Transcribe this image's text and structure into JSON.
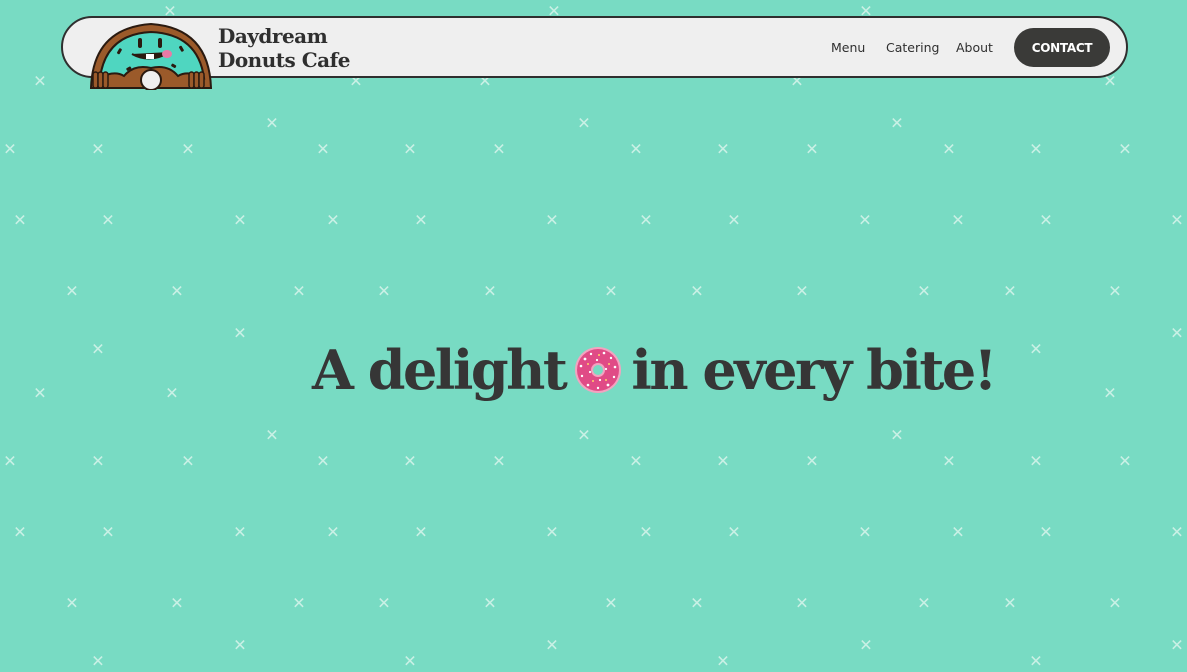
{
  "brand": {
    "line1": "Daydream",
    "line2": "Donuts Cafe",
    "mascot_icon": "donut-mascot-icon"
  },
  "nav": {
    "menu": "Menu",
    "catering": "Catering",
    "about": "About",
    "contact": "CONTACT"
  },
  "hero": {
    "part1": "A delight",
    "part2": "in every bite!",
    "emoji_icon": "pink-sprinkle-donut-icon"
  },
  "colors": {
    "background": "#78dbc3",
    "pattern": "#c9f0e5",
    "navbar": "#efefef",
    "text": "#363636",
    "button": "#3a3a38",
    "donut_frosting": "#e04b86"
  }
}
